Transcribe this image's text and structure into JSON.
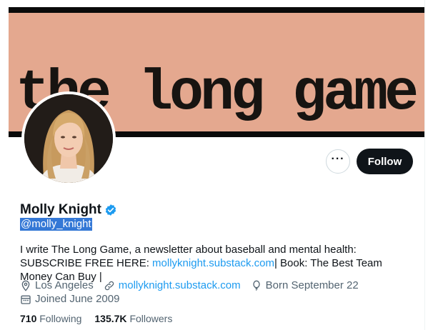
{
  "banner": {
    "text": "the long game."
  },
  "header": {
    "more_label": "···",
    "follow_label": "Follow"
  },
  "profile": {
    "name": "Molly Knight",
    "handle": "@molly_knight",
    "bio_text_1": "I write The Long Game, a newsletter about baseball and mental health: SUBSCRIBE FREE HERE: ",
    "bio_link": "mollyknight.substack.com",
    "bio_text_2": "| Book: The Best Team Money Can Buy |",
    "location": "Los Angeles",
    "website": "mollyknight.substack.com",
    "born": "Born September 22",
    "joined": "Joined June 2009"
  },
  "stats": {
    "following_count": "710",
    "following_label": "Following",
    "followers_count": "135.7K",
    "followers_label": "Followers"
  },
  "colors": {
    "accent": "#1d9bf0",
    "banner_bg": "#e4a88f",
    "text": "#0f1419",
    "muted": "#536471"
  }
}
